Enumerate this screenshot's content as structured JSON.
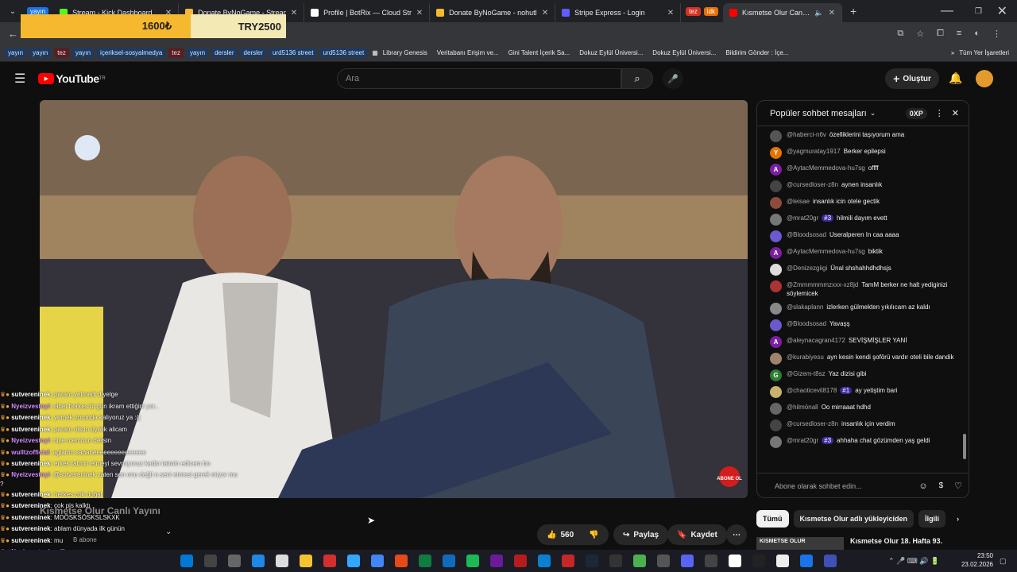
{
  "tabs": [
    {
      "label": "Stream - Kick Dashboard",
      "color": "#53fc18"
    },
    {
      "label": "Donate ByNoGame - Streamer",
      "color": "#f5b82e"
    },
    {
      "label": "Profile | BotRix — Cloud Stream",
      "color": "#ffffff"
    },
    {
      "label": "Donate ByNoGame - nohutlufa",
      "color": "#f5b82e"
    },
    {
      "label": "Stripe Express - Login",
      "color": "#635bff"
    }
  ],
  "tab_first_pill": "yayın",
  "tab_pills": [
    "tez",
    "idk"
  ],
  "active_tab": "Kısmetse Olur Canlı Yayını",
  "donate": {
    "amount_try": "1600₺",
    "amount_code": "TRY2500"
  },
  "bookmarks": {
    "chips": [
      "yayın",
      "yayın",
      "tez",
      "yayın",
      "içeriksel-sosyalmedya",
      "tez",
      "yayın",
      "dersler",
      "dersler",
      "urd5136 street",
      "urd5136 street"
    ],
    "links": [
      "Library Genesis",
      "Veritabanı Erişim ve...",
      "Gini Talent İçerik Sa...",
      "Dokuz Eylül Üniversi...",
      "Dokuz Eylül Üniversi...",
      "Bildirim Gönder : İçe..."
    ],
    "all": "Tüm Yer İşaretleri"
  },
  "youtube": {
    "logo": "YouTube",
    "logo_sup": "TR",
    "search_placeholder": "Ara",
    "create": "Oluştur"
  },
  "chat": {
    "header": "Popüler sohbet mesajları",
    "xp": "0XP",
    "input_placeholder": "Abone olarak sohbet edin...",
    "messages": [
      {
        "user": "@haberci-n6v",
        "text": "özelliklerini taşıyorum ama",
        "color": "#555",
        "badge": ""
      },
      {
        "user": "@yagmuratay1917",
        "text": "Berker epilepsi",
        "color": "#e37400",
        "initial": "Y",
        "badge": ""
      },
      {
        "user": "@AytacMemmedova-hu7sg",
        "text": "offff",
        "color": "#7b1fa2",
        "initial": "A",
        "badge": ""
      },
      {
        "user": "@cursedloser-z8n",
        "text": "aynen insanlık",
        "color": "#444",
        "badge": ""
      },
      {
        "user": "@leisae",
        "text": "insanlık icin otele gectik",
        "color": "#8d4b3a",
        "badge": ""
      },
      {
        "user": "@mrat20gr",
        "text": "hilmili dayım evett",
        "color": "#777",
        "badge": "#3"
      },
      {
        "user": "@Bloodsosad",
        "text": "Useralperen In caa aaaa",
        "color": "#6a5acd",
        "badge": ""
      },
      {
        "user": "@AytacMemmedova-hu7sg",
        "text": "biktik",
        "color": "#7b1fa2",
        "initial": "A",
        "badge": ""
      },
      {
        "user": "@Denizezgiigi",
        "text": "Ünal shshahhdhdhsjs",
        "color": "#ddd",
        "badge": ""
      },
      {
        "user": "@Zmmmmmmzxxx-xz8jd",
        "text": "TamM berker ne halt yediginizi söylemicek",
        "color": "#a33",
        "badge": ""
      },
      {
        "user": "@slakaplann",
        "text": "izlerken gülmekten yıkılıcam az kaldı",
        "color": "#888",
        "badge": ""
      },
      {
        "user": "@Bloodsosad",
        "text": "Yavaşş",
        "color": "#6a5acd",
        "badge": ""
      },
      {
        "user": "@aleynacagran4172",
        "text": "SEVİŞMİŞLER YANİ",
        "color": "#7b1fa2",
        "initial": "A",
        "badge": ""
      },
      {
        "user": "@kurabiyesu",
        "text": "ayn kesin kendi şoförü vardır oteli bile dandik",
        "color": "#a0826d",
        "badge": ""
      },
      {
        "user": "@Gizem-t8sz",
        "text": "Yaz dizisi gibi",
        "color": "#2e7d32",
        "initial": "G",
        "badge": ""
      },
      {
        "user": "@chaoticevil8178",
        "text": "ay yetiştim bari",
        "color": "#c9b26b",
        "badge": "#1"
      },
      {
        "user": "@hilmönall",
        "text": "Oo mirraaat hdhd",
        "color": "#666",
        "badge": ""
      },
      {
        "user": "@cursedloser-z8n",
        "text": "insanlık için verdim",
        "color": "#444",
        "badge": ""
      },
      {
        "user": "@mrat20gr",
        "text": "ahhaha chat gözümden yaş geldi",
        "color": "#777",
        "badge": "#3"
      }
    ]
  },
  "overlay_chat": [
    {
      "n": "sutvereninek",
      "t": ": param yetmedi diyelge",
      "p": false
    },
    {
      "n": "Nyeizvestnyi",
      "t": ": elbet herkes bi gün ikram ettiğini yer..",
      "p": true
    },
    {
      "n": "sutvereninek",
      "t": ": yemek zorunda kaliyoruz ya :((",
      "p": false
    },
    {
      "n": "sutvereninek",
      "t": ": param olsun üyelik alicam",
      "p": false
    },
    {
      "n": "Nyeizvestnyi",
      "t": ": niye memnun deilsin",
      "p": true
    },
    {
      "n": "wulltzofficial",
      "t": ": aglarim sananeeeeeeeeeeeeeee",
      "p": true
    },
    {
      "n": "sutvereninek",
      "t": ": erkek tatmin etmeyi sevmiyoruz kadin tatmin edicem bn",
      "p": false
    },
    {
      "n": "Nyeizvestnyi",
      "t": ": @sutvereninek zaten sen onu değil o seni etmesi gerek miyor mu ?",
      "p": true
    },
    {
      "n": "sutvereninek",
      "t": ": herkes çok doğal",
      "p": false
    },
    {
      "n": "sutvereninek",
      "t": ": çok pis kalktı",
      "p": false
    },
    {
      "n": "sutvereninek",
      "t": ": MDÖSKSÖSKSLSKXK",
      "p": false
    },
    {
      "n": "sutvereninek",
      "t": ": ablam dünyada ilk günün",
      "p": false
    },
    {
      "n": "sutvereninek",
      "t": ": mu",
      "p": false
    },
    {
      "n": "Nyeizvestnyi",
      "t": ": galiba",
      "p": true
    },
    {
      "n": "sutvereninek",
      "t": ": kdşskşsksksksksksls",
      "p": false
    }
  ],
  "video": {
    "title": "Kısmetse Olur Canlı Yayını",
    "channel_subs": "B abone",
    "abone": "ABONE OL"
  },
  "actions": {
    "likes": "560",
    "share": "Paylaş",
    "save": "Kaydet"
  },
  "filters": [
    "Tümü",
    "Kısmetse Olur adlı yükleyiciden",
    "İlgili"
  ],
  "rec": {
    "thumb": "KISMETSE OLUR",
    "title": "Kısmetse Olur 18. Hafta 93."
  },
  "clock": {
    "time": "23:50",
    "date": "23.02.2026"
  }
}
